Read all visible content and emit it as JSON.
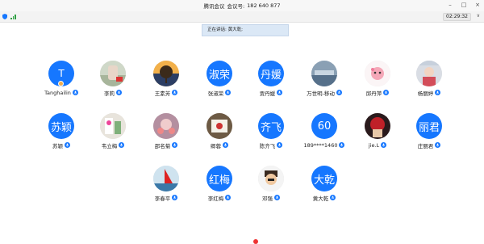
{
  "window": {
    "title": "腾讯会议",
    "meeting_id_label": "会议号:",
    "meeting_id": "182 640 877",
    "controls": [
      "–",
      "□",
      "×"
    ]
  },
  "status": {
    "elapsed": "02:29:32",
    "more_label": "∨",
    "signal_color": "#2ea043"
  },
  "speaking": {
    "label": "正在讲话:",
    "name": "黄大乾;"
  },
  "colors": {
    "accent": "#1677ff",
    "speaking_bg": "#dbe8f6"
  },
  "participants": [
    {
      "name": "Tanghailin",
      "avatar_text": "T",
      "avatar_type": "text",
      "host": true,
      "mic": "on"
    },
    {
      "name": "李莉",
      "avatar_type": "photo",
      "mic": "on"
    },
    {
      "name": "王素芳",
      "avatar_type": "photo",
      "mic": "on"
    },
    {
      "name": "张淑荣",
      "avatar_text": "淑荣",
      "avatar_type": "text",
      "mic": "on"
    },
    {
      "name": "贾丹媛",
      "avatar_text": "丹媛",
      "avatar_type": "text",
      "mic": "on"
    },
    {
      "name": "万世明-移动",
      "avatar_type": "photo",
      "mic": "talking"
    },
    {
      "name": "邱丹萍",
      "avatar_type": "photo",
      "mic": "on"
    },
    {
      "name": "杨丽婷",
      "avatar_type": "photo",
      "mic": "on"
    },
    {
      "name": "苏颖",
      "avatar_text": "苏颖",
      "avatar_type": "text",
      "mic": "on"
    },
    {
      "name": "韦立梅",
      "avatar_type": "photo",
      "mic": "on"
    },
    {
      "name": "邵名菊",
      "avatar_type": "photo",
      "mic": "on"
    },
    {
      "name": "卿蓉",
      "avatar_type": "photo",
      "mic": "on"
    },
    {
      "name": "陈齐飞",
      "avatar_text": "齐飞",
      "avatar_type": "text",
      "mic": "on"
    },
    {
      "name": "189****1460",
      "avatar_text": "60",
      "avatar_type": "text",
      "mic": "on"
    },
    {
      "name": "jie.L",
      "avatar_type": "photo",
      "mic": "on"
    },
    {
      "name": "庄丽君",
      "avatar_text": "丽君",
      "avatar_type": "text",
      "mic": "on"
    },
    {
      "name": "李春平",
      "avatar_type": "photo",
      "mic": "on"
    },
    {
      "name": "李红梅",
      "avatar_text": "红梅",
      "avatar_type": "text",
      "mic": "on"
    },
    {
      "name": "邓强",
      "avatar_type": "photo",
      "mic": "on"
    },
    {
      "name": "黄大乾",
      "avatar_text": "大乾",
      "avatar_type": "text",
      "mic": "talking"
    }
  ]
}
